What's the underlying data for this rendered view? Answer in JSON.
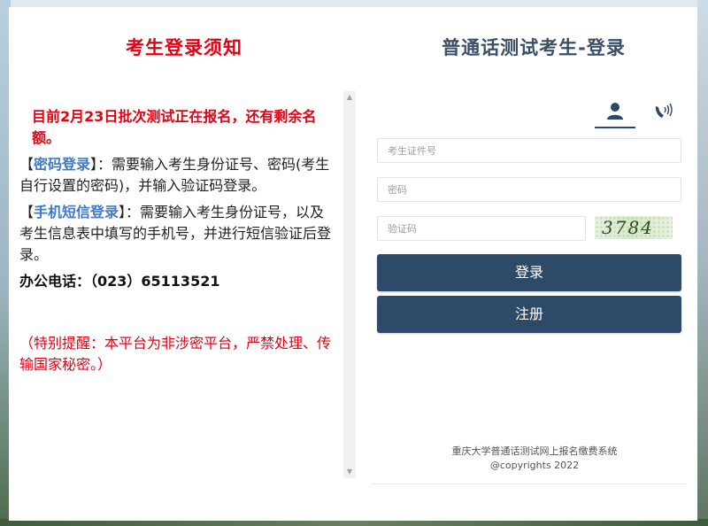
{
  "notice": {
    "title": "考生登录须知",
    "line1": "目前2月23日批次测试正在报名，还有剩余名额。",
    "pwd_open": "【",
    "pwd_keyword": "密码登录",
    "pwd_close": "】：",
    "pwd_text": "需要输入考生身份证号、密码(考生自行设置的密码)，并输入验证码登录。",
    "sms_open": "【",
    "sms_keyword": "手机短信登录",
    "sms_close": "】：",
    "sms_text": "需要输入考生身份证号，以及考生信息表中填写的手机号，并进行短信验证后登录。",
    "phone": "办公电话：（023）65113521",
    "warning": "（特别提醒：本平台为非涉密平台，严禁处理、传输国家秘密。）"
  },
  "login": {
    "title": "普通话测试考生-登录",
    "tabs": [
      {
        "icon": "user-icon",
        "active": true
      },
      {
        "icon": "phone-icon",
        "active": false
      }
    ],
    "id_placeholder": "考生证件号",
    "password_placeholder": "密码",
    "captcha_placeholder": "验证码",
    "captcha_code": "3784",
    "login_button": "登录",
    "register_button": "注册"
  },
  "footer": {
    "system_name": "重庆大学普通话测试网上报名缴费系统",
    "copyright": "@copyrights 2022"
  },
  "colors": {
    "notice_title": "#e60012",
    "keyword": "#3f7ac6",
    "button": "#2e4a69",
    "login_title": "#3b4f66"
  }
}
